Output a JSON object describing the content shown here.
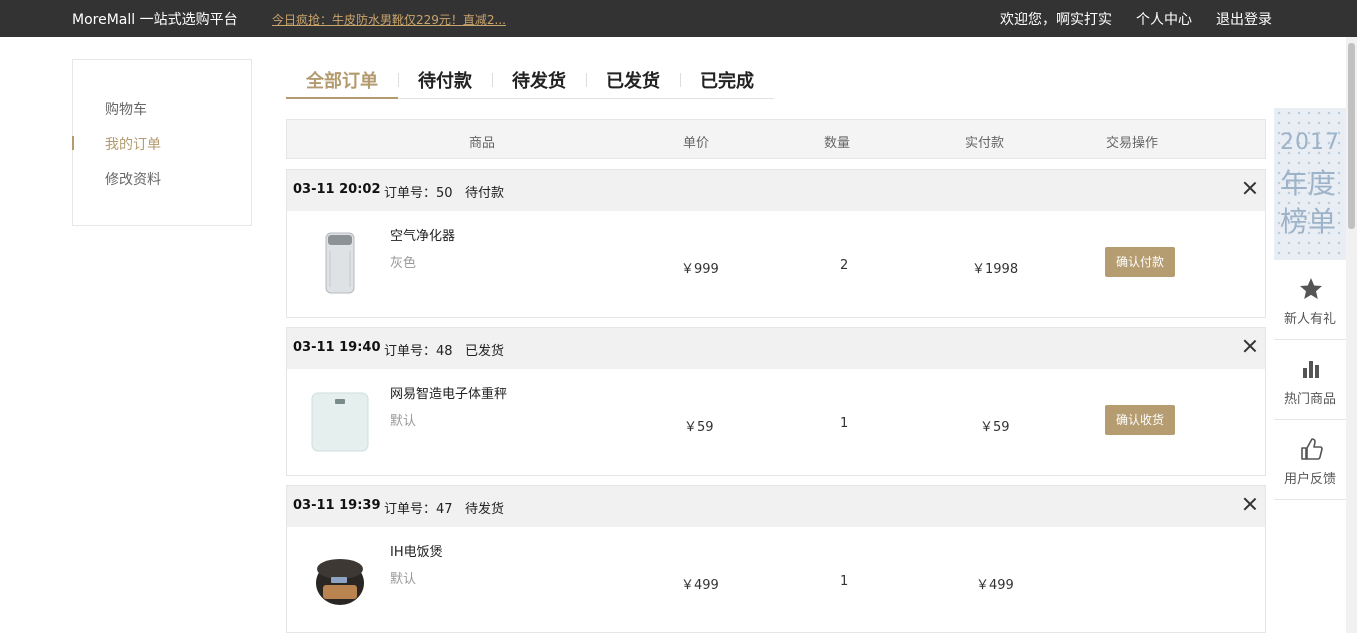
{
  "topbar": {
    "brand": "MoreMall 一站式选购平台",
    "promo": "今日疯抢：牛皮防水男靴仅229元！直减2...",
    "welcome": "欢迎您，啊实打实",
    "profile": "个人中心",
    "logout": "退出登录"
  },
  "sidebar": {
    "items": [
      {
        "label": "购物车"
      },
      {
        "label": "我的订单",
        "active": true
      },
      {
        "label": "修改资料"
      }
    ]
  },
  "tabs": [
    {
      "label": "全部订单",
      "active": true
    },
    {
      "label": "待付款"
    },
    {
      "label": "待发货"
    },
    {
      "label": "已发货"
    },
    {
      "label": "已完成"
    }
  ],
  "table_header": {
    "product": "商品",
    "price": "单价",
    "qty": "数量",
    "paid": "实付款",
    "action": "交易操作"
  },
  "orders": [
    {
      "time": "03-11 20:02",
      "order_no": "订单号：50",
      "status": "待付款",
      "product_name": "空气净化器",
      "spec": "灰色",
      "price": "￥999",
      "qty": "2",
      "paid": "￥1998",
      "action": "确认付款",
      "thumb": "air-purifier"
    },
    {
      "time": "03-11 19:40",
      "order_no": "订单号：48",
      "status": "已发货",
      "product_name": "网易智造电子体重秤",
      "spec": "默认",
      "price": "￥59",
      "qty": "1",
      "paid": "￥59",
      "action": "确认收货",
      "thumb": "scale"
    },
    {
      "time": "03-11 19:39",
      "order_no": "订单号：47",
      "status": "待发货",
      "product_name": "IH电饭煲",
      "spec": "默认",
      "price": "￥499",
      "qty": "1",
      "paid": "￥499",
      "action": "",
      "thumb": "rice-cooker"
    }
  ],
  "rightbar": {
    "ad": {
      "line1": "2017",
      "line2": "年度",
      "line3": "榜单"
    },
    "items": [
      {
        "label": "新人有礼",
        "icon": "star-icon"
      },
      {
        "label": "热门商品",
        "icon": "bar-chart-icon"
      },
      {
        "label": "用户反馈",
        "icon": "thumbs-up-icon"
      }
    ]
  },
  "colors": {
    "accent": "#b49b6f",
    "topbar": "#333333",
    "button": "#b59c71"
  }
}
